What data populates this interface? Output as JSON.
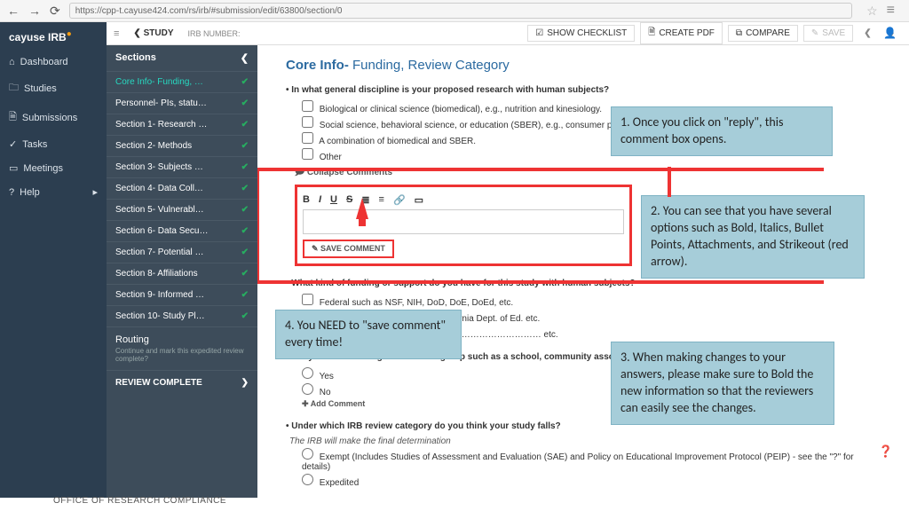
{
  "url": "https://cpp-t.cayuse424.com/rs/irb/#submission/edit/63800/section/0",
  "brand": "cayuse IRB",
  "leftnav": [
    "Dashboard",
    "Studies",
    "Submissions",
    "Tasks",
    "Meetings",
    "Help"
  ],
  "leftnavIcons": [
    "⌂",
    "🗀",
    "🗎",
    "✓",
    "▭",
    "?"
  ],
  "studyBtn": "STUDY",
  "irbNumberLabel": "IRB NUMBER:",
  "sectionsHdr": "Sections",
  "sections": [
    "Core Info- Funding, …",
    "Personnel- PIs, statu…",
    "Section 1- Research …",
    "Section 2- Methods",
    "Section 3- Subjects …",
    "Section 4- Data Coll…",
    "Section 5- Vulnerabl…",
    "Section 6- Data Secu…",
    "Section 7- Potential …",
    "Section 8- Affiliations",
    "Section 9- Informed …",
    "Section 10- Study Pl…"
  ],
  "routing": {
    "title": "Routing",
    "sub": "Continue and mark this expedited review complete?"
  },
  "reviewComplete": "REVIEW COMPLETE",
  "topbar": {
    "checklist": "SHOW CHECKLIST",
    "pdf": "CREATE PDF",
    "compare": "COMPARE",
    "save": "SAVE"
  },
  "coreTitle": {
    "a": "Core Info- ",
    "b": "Funding, Review Category"
  },
  "q1": "• In what general discipline is your proposed research with human subjects?",
  "q1opts": [
    "Biological or clinical science (biomedical), e.g., nutrition and kinesiology.",
    "Social science, behavioral science, or education (SBER), e.g., consumer preference and psychology.",
    "A combination of biomedical and SBER.",
    "Other"
  ],
  "collapse": "🗩 Collapse Comments",
  "saveComment": "✎ SAVE COMMENT",
  "q2": "• What kind of funding or support do you have for this study with human subjects?",
  "q2opts": [
    "Federal such as NSF, NIH, DoD, DoE, DoEd, etc.",
    "State agency such as CARB, California Dept. of Ed. etc.",
    "………………………………………………………………… etc."
  ],
  "q3": "• Are you collaborating with another group such as a school, community association, government agen",
  "q3opts": [
    "Yes",
    "No"
  ],
  "addComment": "✚ Add Comment",
  "q4": "• Under which IRB review category do you think your study falls?",
  "q4note": "The IRB will make the final determination",
  "q4opts": [
    "Exempt  (Includes Studies of Assessment and Evaluation (SAE) and Policy on Educational Improvement Protocol (PEIP) - see the \"?\" for details)",
    "Expedited"
  ],
  "callouts": {
    "c1": "1. Once you click on \"reply\", this comment box opens.",
    "c2": "2. You can see that you have several options such as Bold, Italics, Bullet Points, Attachments, and Strikeout (red arrow).",
    "c3": "3. When making changes to your answers, please make sure to Bold the new information so that the reviewers can easily see the changes.",
    "c4": "4. You NEED to \"save comment\" every time!"
  },
  "footer": "OFFICE OF RESEARCH COMPLIANCE"
}
